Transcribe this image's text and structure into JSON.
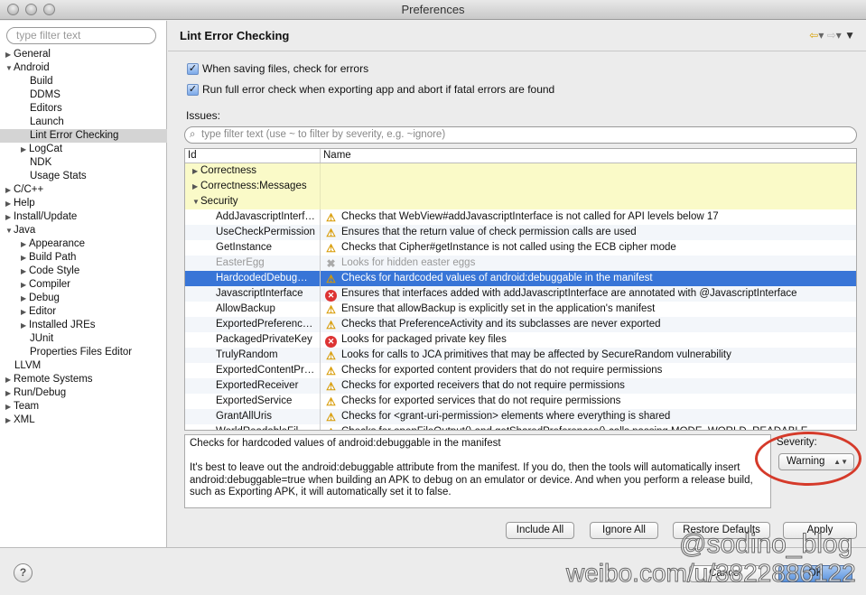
{
  "window": {
    "title": "Preferences"
  },
  "sidebar": {
    "filter_placeholder": "type filter text",
    "items": [
      {
        "label": "General",
        "level": 0,
        "tw": "▶"
      },
      {
        "label": "Android",
        "level": 0,
        "tw": "▼"
      },
      {
        "label": "Build",
        "level": 1,
        "tw": ""
      },
      {
        "label": "DDMS",
        "level": 1,
        "tw": ""
      },
      {
        "label": "Editors",
        "level": 1,
        "tw": ""
      },
      {
        "label": "Launch",
        "level": 1,
        "tw": ""
      },
      {
        "label": "Lint Error Checking",
        "level": 1,
        "tw": "",
        "selected": true
      },
      {
        "label": "LogCat",
        "level": 1,
        "tw": "▶"
      },
      {
        "label": "NDK",
        "level": 1,
        "tw": ""
      },
      {
        "label": "Usage Stats",
        "level": 1,
        "tw": ""
      },
      {
        "label": "C/C++",
        "level": 0,
        "tw": "▶"
      },
      {
        "label": "Help",
        "level": 0,
        "tw": "▶"
      },
      {
        "label": "Install/Update",
        "level": 0,
        "tw": "▶"
      },
      {
        "label": "Java",
        "level": 0,
        "tw": "▼"
      },
      {
        "label": "Appearance",
        "level": 1,
        "tw": "▶"
      },
      {
        "label": "Build Path",
        "level": 1,
        "tw": "▶"
      },
      {
        "label": "Code Style",
        "level": 1,
        "tw": "▶"
      },
      {
        "label": "Compiler",
        "level": 1,
        "tw": "▶"
      },
      {
        "label": "Debug",
        "level": 1,
        "tw": "▶"
      },
      {
        "label": "Editor",
        "level": 1,
        "tw": "▶"
      },
      {
        "label": "Installed JREs",
        "level": 1,
        "tw": "▶"
      },
      {
        "label": "JUnit",
        "level": 1,
        "tw": ""
      },
      {
        "label": "Properties Files Editor",
        "level": 1,
        "tw": ""
      },
      {
        "label": "LLVM",
        "level": 0,
        "tw": ""
      },
      {
        "label": "Remote Systems",
        "level": 0,
        "tw": "▶"
      },
      {
        "label": "Run/Debug",
        "level": 0,
        "tw": "▶"
      },
      {
        "label": "Team",
        "level": 0,
        "tw": "▶"
      },
      {
        "label": "XML",
        "level": 0,
        "tw": "▶"
      }
    ]
  },
  "main": {
    "title": "Lint Error Checking",
    "check_save": "When saving files, check for errors",
    "check_export": "Run full error check when exporting app and abort if fatal errors are found",
    "issues_label": "Issues:",
    "filter_placeholder": "type filter text (use ~ to filter by severity, e.g. ~ignore)",
    "columns": [
      "Id",
      "Name"
    ],
    "rows": [
      {
        "id": "Correctness",
        "name": "",
        "type": "cat",
        "tw": "▶"
      },
      {
        "id": "Correctness:Messages",
        "name": "",
        "type": "cat",
        "tw": "▶"
      },
      {
        "id": "Security",
        "name": "",
        "type": "cat",
        "tw": "▼"
      },
      {
        "id": "AddJavascriptInterf…",
        "name": "Checks that WebView#addJavascriptInterface is not called for API levels below 17",
        "sev": "warning"
      },
      {
        "id": "UseCheckPermission",
        "name": "Ensures that the return value of check permission calls are used",
        "sev": "warning"
      },
      {
        "id": "GetInstance",
        "name": "Checks that Cipher#getInstance is not called using the ECB cipher mode",
        "sev": "warning"
      },
      {
        "id": "EasterEgg",
        "name": "Looks for hidden easter eggs",
        "sev": "ignore"
      },
      {
        "id": "HardcodedDebug…",
        "name": "Checks for hardcoded values of android:debuggable in the manifest",
        "sev": "warning",
        "selected": true
      },
      {
        "id": "JavascriptInterface",
        "name": "Ensures that interfaces added with addJavascriptInterface are annotated with @JavascriptInterface",
        "sev": "error"
      },
      {
        "id": "AllowBackup",
        "name": "Ensure that allowBackup is explicitly set in the application's manifest",
        "sev": "warning"
      },
      {
        "id": "ExportedPreferenc…",
        "name": "Checks that PreferenceActivity and its subclasses are never exported",
        "sev": "warning"
      },
      {
        "id": "PackagedPrivateKey",
        "name": "Looks for packaged private key files",
        "sev": "error"
      },
      {
        "id": "TrulyRandom",
        "name": "Looks for calls to JCA primitives that may be affected by SecureRandom vulnerability",
        "sev": "warning"
      },
      {
        "id": "ExportedContentPr…",
        "name": "Checks for exported content providers that do not require permissions",
        "sev": "warning"
      },
      {
        "id": "ExportedReceiver",
        "name": "Checks for exported receivers that do not require permissions",
        "sev": "warning"
      },
      {
        "id": "ExportedService",
        "name": "Checks for exported services that do not require permissions",
        "sev": "warning"
      },
      {
        "id": "GrantAllUris",
        "name": "Checks for <grant-uri-permission> elements where everything is shared",
        "sev": "warning"
      },
      {
        "id": "WorldReadableFil…",
        "name": "Checks for openFileOutput() and getSharedPreferences() calls passing MODE_WORLD_READABLE",
        "sev": "warning"
      }
    ],
    "description": "Checks for hardcoded values of android:debuggable in the manifest\n\nIt's best to leave out the android:debuggable attribute from the manifest. If you do, then the tools will automatically insert android:debuggable=true when building an APK to debug on an emulator or device. And when you perform a release build, such as Exporting APK, it will automatically set it to false.",
    "severity_label": "Severity:",
    "severity_value": "Warning",
    "buttons": {
      "include_all": "Include All",
      "ignore_all": "Ignore All",
      "restore_defaults": "Restore Defaults",
      "apply": "Apply"
    }
  },
  "footer": {
    "help": "?",
    "cancel": "Cancel",
    "ok": "OK"
  },
  "watermark": {
    "line1": "@sodino_blog",
    "line2": "weibo.com/u/3822886122"
  },
  "colors": {
    "selection": "#3875d7",
    "category_bg": "#fafac8",
    "annotation_circle": "#d53a2a"
  }
}
